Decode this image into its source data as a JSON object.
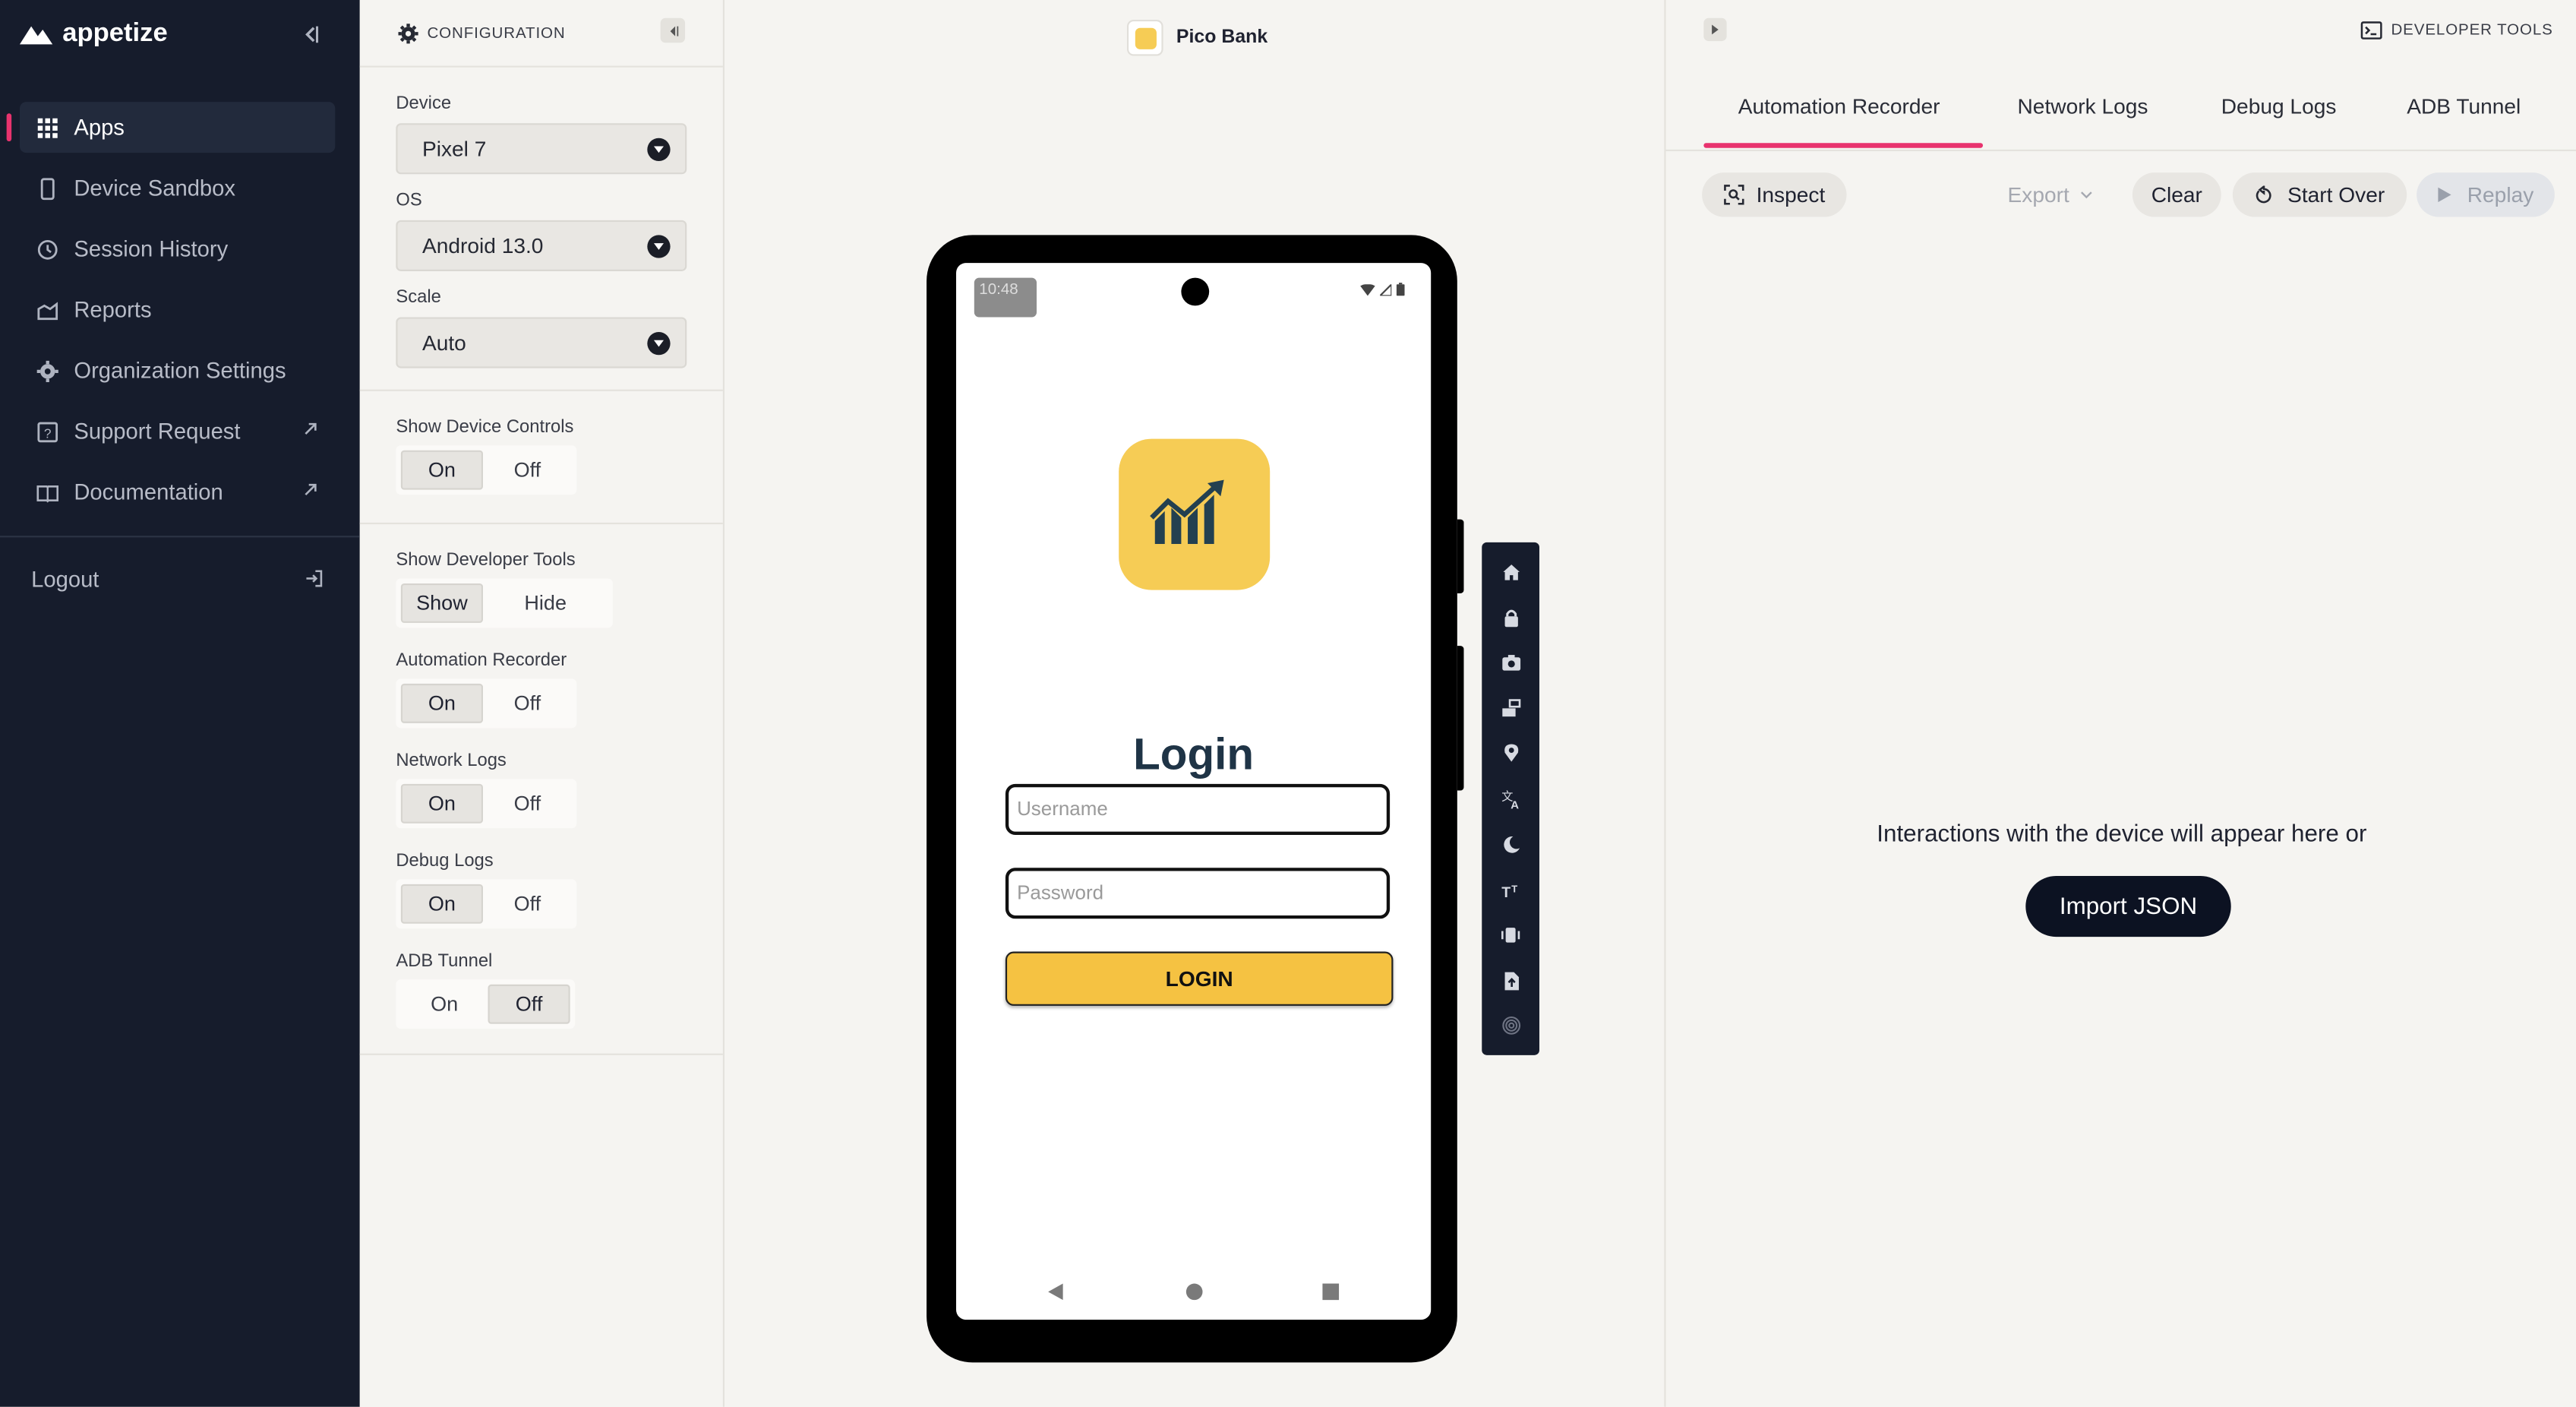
{
  "brand": {
    "name": "appetize"
  },
  "sidebar": {
    "items": [
      {
        "label": "Apps",
        "icon": "grid-icon",
        "active": true
      },
      {
        "label": "Device Sandbox",
        "icon": "phone-icon"
      },
      {
        "label": "Session History",
        "icon": "history-icon"
      },
      {
        "label": "Reports",
        "icon": "reports-icon"
      },
      {
        "label": "Organization Settings",
        "icon": "gear-icon"
      },
      {
        "label": "Support Request",
        "icon": "help-icon",
        "external": true
      },
      {
        "label": "Documentation",
        "icon": "book-icon",
        "external": true
      }
    ],
    "logout": "Logout"
  },
  "config": {
    "title": "CONFIGURATION",
    "device": {
      "label": "Device",
      "value": "Pixel 7"
    },
    "os": {
      "label": "OS",
      "value": "Android 13.0"
    },
    "scale": {
      "label": "Scale",
      "value": "Auto"
    },
    "show_device_controls": {
      "label": "Show Device Controls",
      "on": "On",
      "off": "Off",
      "selected": "On"
    },
    "show_developer_tools": {
      "label": "Show Developer Tools",
      "on": "Show",
      "off": "Hide",
      "selected": "Show"
    },
    "automation_recorder": {
      "label": "Automation Recorder",
      "on": "On",
      "off": "Off",
      "selected": "On"
    },
    "network_logs": {
      "label": "Network Logs",
      "on": "On",
      "off": "Off",
      "selected": "On"
    },
    "debug_logs": {
      "label": "Debug Logs",
      "on": "On",
      "off": "Off",
      "selected": "On"
    },
    "adb_tunnel": {
      "label": "ADB Tunnel",
      "on": "On",
      "off": "Off",
      "selected": "Off"
    }
  },
  "app": {
    "title": "Pico Bank"
  },
  "device_screen": {
    "status_time": "10:48",
    "login_title": "Login",
    "username_placeholder": "Username",
    "password_placeholder": "Password",
    "login_button": "LOGIN",
    "accent": "#f6cc55"
  },
  "device_tools": [
    "home-icon",
    "lock-icon",
    "camera-icon",
    "rotate-icon",
    "location-icon",
    "language-icon",
    "dark-mode-icon",
    "font-size-icon",
    "vibrate-icon",
    "upload-icon",
    "fingerprint-icon"
  ],
  "developer": {
    "title": "DEVELOPER TOOLS",
    "tabs": [
      "Automation Recorder",
      "Network Logs",
      "Debug Logs",
      "ADB Tunnel"
    ],
    "active_tab": "Automation Recorder",
    "inspect": "Inspect",
    "export": "Export",
    "clear": "Clear",
    "start_over": "Start Over",
    "replay": "Replay",
    "empty_message": "Interactions with the device will appear here or",
    "import_json": "Import JSON",
    "accent": "#e8336e"
  }
}
